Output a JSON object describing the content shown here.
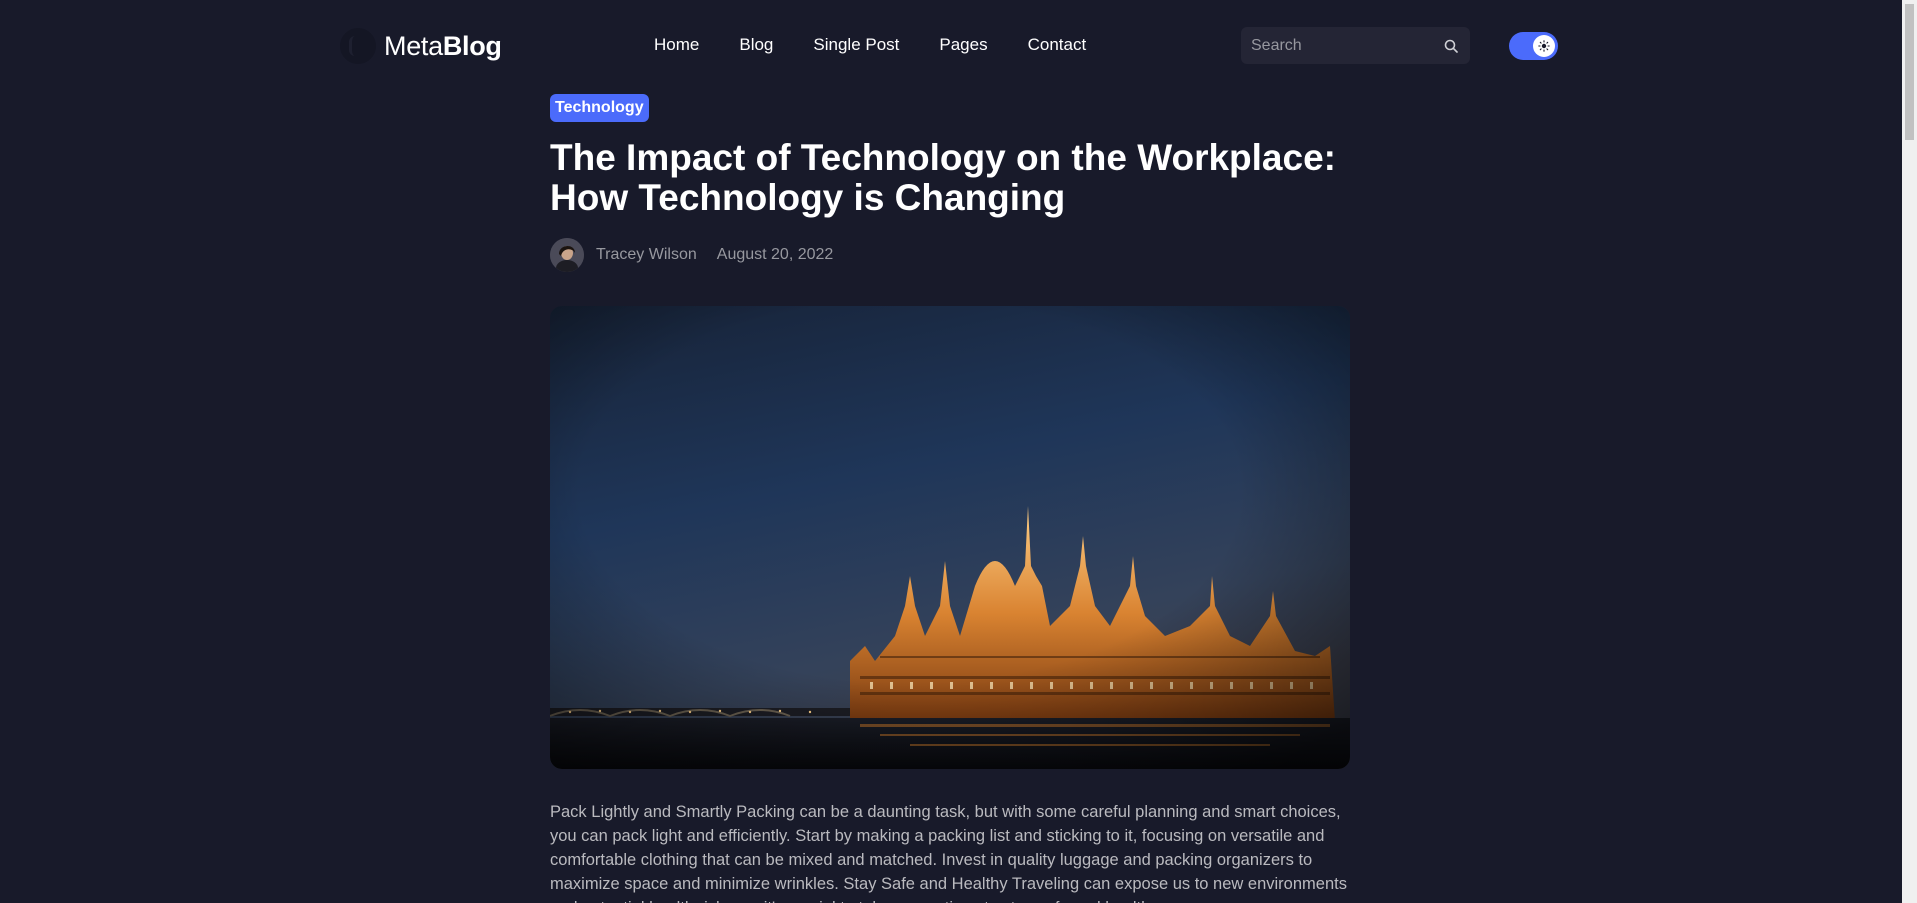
{
  "logo": {
    "part1": "Meta",
    "part2": "Blog"
  },
  "nav": {
    "items": [
      "Home",
      "Blog",
      "Single Post",
      "Pages",
      "Contact"
    ]
  },
  "search": {
    "placeholder": "Search",
    "value": ""
  },
  "theme_toggle": {
    "state": "dark"
  },
  "article": {
    "category": "Technology",
    "title_line1": "The Impact of Technology on the Workplace:",
    "title_line2": "How Technology is Changing",
    "author": "Tracey Wilson",
    "date": "August 20, 2022",
    "body": "Pack Lightly and Smartly Packing can be a daunting task, but with some careful planning and smart choices, you can pack light and efficiently. Start by making a packing list and sticking to it, focusing on versatile and comfortable clothing that can be mixed and matched. Invest in quality luggage and packing organizers to maximize space and minimize wrinkles. Stay Safe and Healthy Traveling can expose us to new environments and potential health risks, so it's crucial to take precautions to stay safe and healthy."
  },
  "colors": {
    "background": "#181a2a",
    "accent": "#4b6bfb",
    "muted_text": "#97989f",
    "body_text": "#bababf"
  }
}
